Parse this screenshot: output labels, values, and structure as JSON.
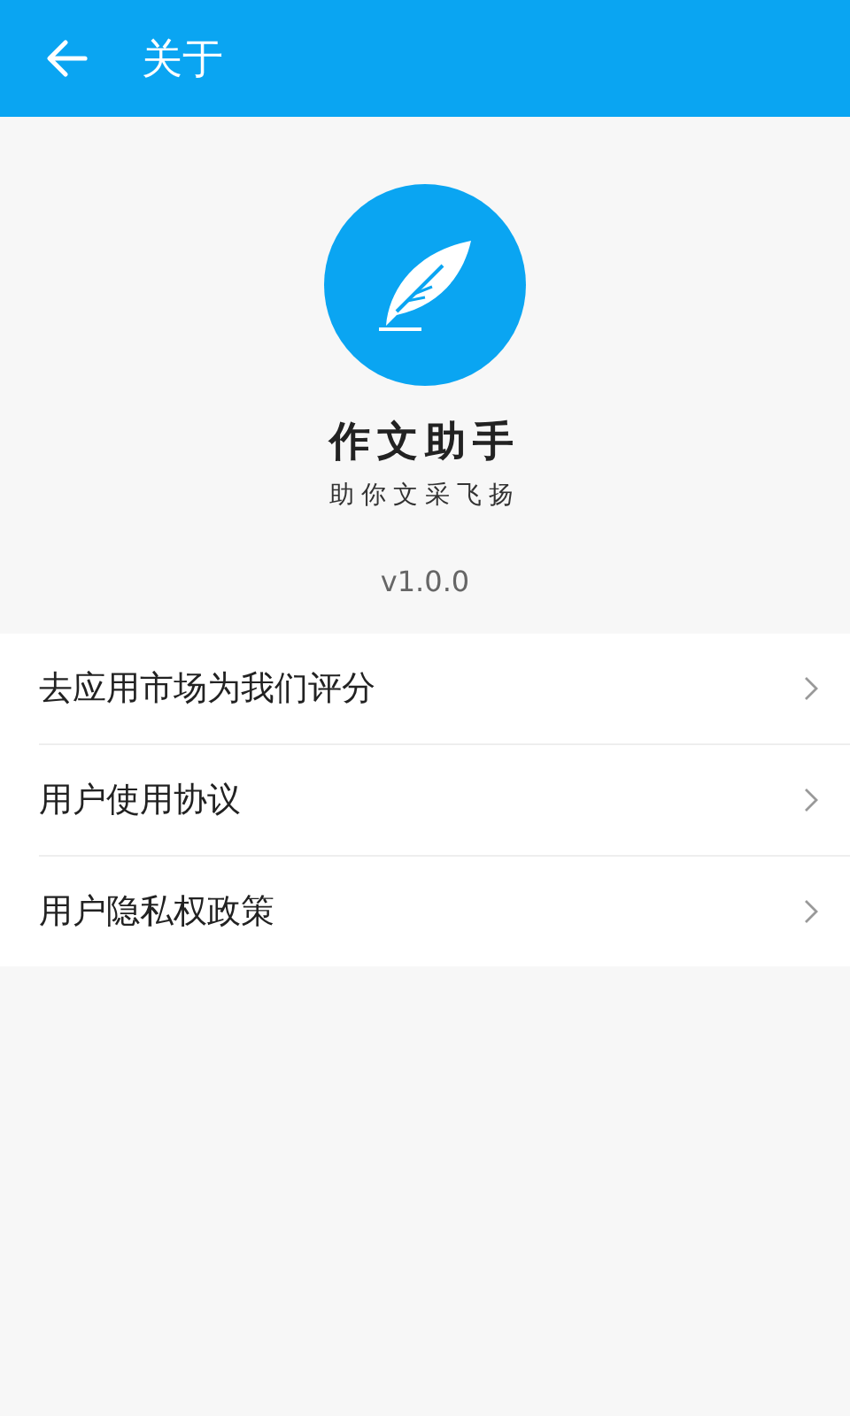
{
  "header": {
    "title": "关于"
  },
  "app": {
    "name": "作文助手",
    "slogan": "助你文采飞扬",
    "version": "v1.0.0"
  },
  "menu": [
    {
      "label": "去应用市场为我们评分"
    },
    {
      "label": "用户使用协议"
    },
    {
      "label": "用户隐私权政策"
    }
  ]
}
